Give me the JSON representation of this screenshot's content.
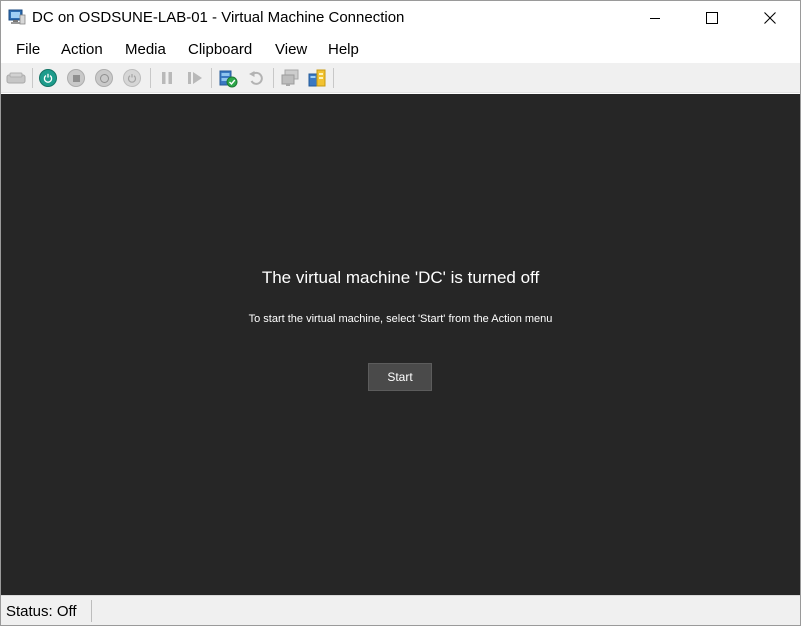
{
  "window": {
    "title": "DC on OSDSUNE-LAB-01 - Virtual Machine Connection"
  },
  "menu": {
    "items": [
      "File",
      "Action",
      "Media",
      "Clipboard",
      "View",
      "Help"
    ]
  },
  "toolbar": {
    "buttons": [
      {
        "icon": "ctrl-alt-del-icon",
        "enabled": false
      },
      {
        "icon": "start-icon",
        "enabled": true
      },
      {
        "icon": "turn-off-icon",
        "enabled": false
      },
      {
        "icon": "shut-down-icon",
        "enabled": false
      },
      {
        "icon": "save-icon",
        "enabled": false
      },
      {
        "icon": "pause-icon",
        "enabled": false
      },
      {
        "icon": "resume-icon",
        "enabled": false
      },
      {
        "icon": "checkpoint-icon",
        "enabled": true
      },
      {
        "icon": "revert-icon",
        "enabled": false
      },
      {
        "icon": "enhanced-session-icon",
        "enabled": false
      },
      {
        "icon": "share-icon",
        "enabled": true
      }
    ],
    "accent_color": "#1e9c8c"
  },
  "console": {
    "title": "The virtual machine 'DC' is turned off",
    "subtitle": "To start the virtual machine, select 'Start' from the Action menu",
    "start_label": "Start",
    "background": "#262626"
  },
  "status": {
    "text": "Status: Off"
  }
}
